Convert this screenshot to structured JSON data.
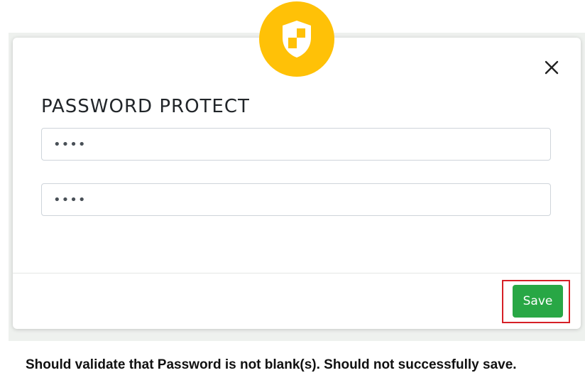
{
  "modal": {
    "title": "PASSWORD PROTECT",
    "badge_icon": "shield-icon",
    "badge_color": "#ffc107",
    "close_icon": "close-icon",
    "password_field": {
      "value": "****"
    },
    "confirm_password_field": {
      "value": "****"
    },
    "save_label": "Save",
    "save_color": "#28a745",
    "highlight_color": "#d61f26"
  },
  "caption": "Should validate that Password is not blank(s). Should not successfully save."
}
